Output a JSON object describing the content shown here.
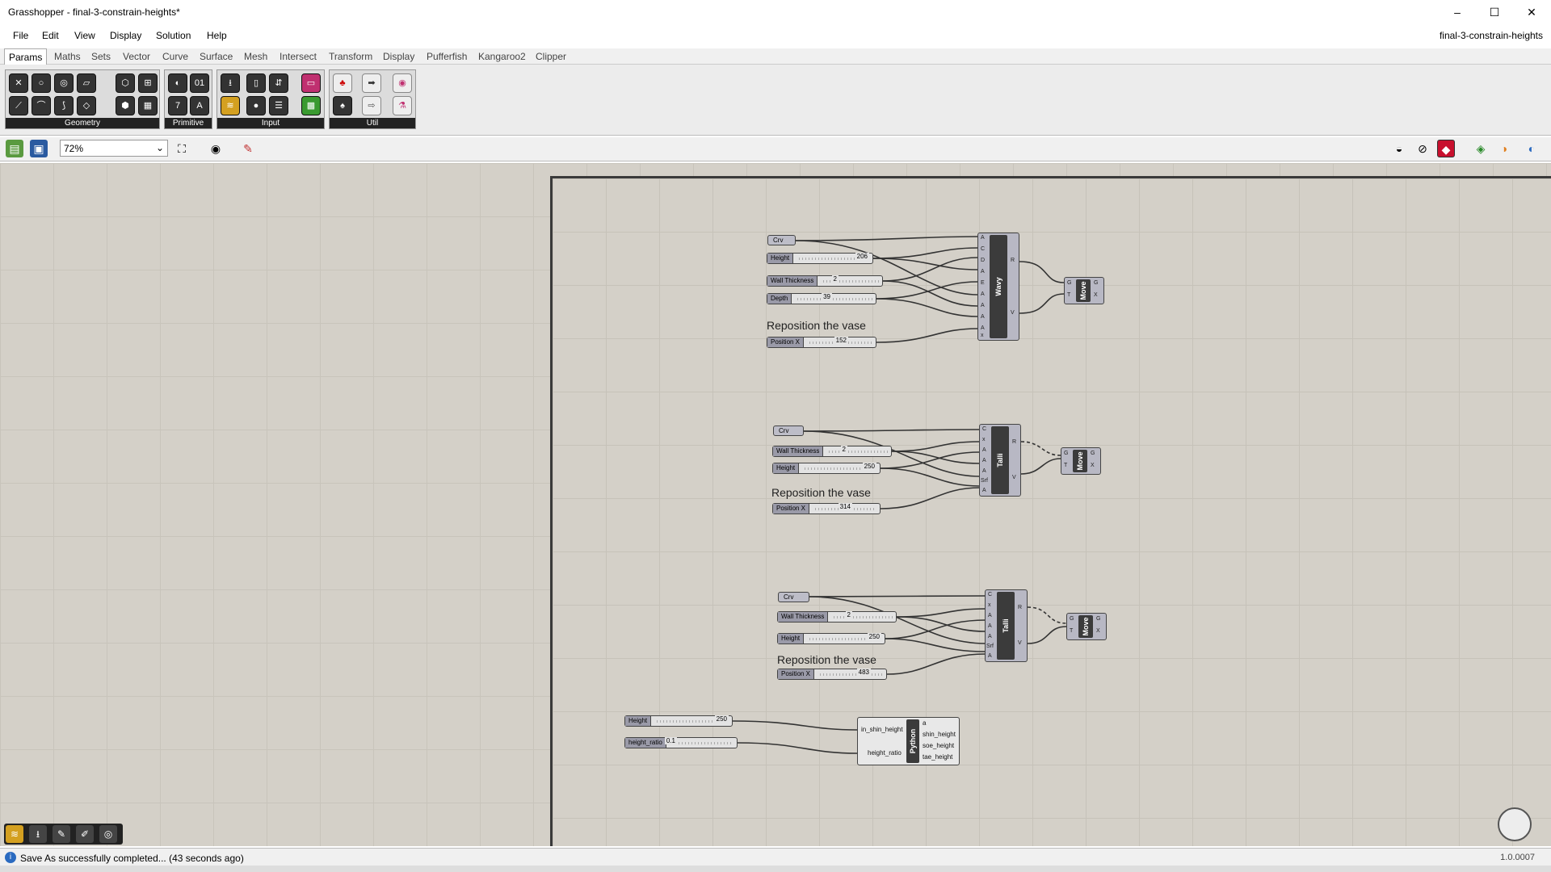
{
  "window": {
    "title": "Grasshopper - final-3-constrain-heights*",
    "doc_name": "final-3-constrain-heights",
    "minimize": "–",
    "maximize": "☐",
    "close": "✕"
  },
  "menu": [
    "File",
    "Edit",
    "View",
    "Display",
    "Solution",
    "Help"
  ],
  "tabs": [
    "Params",
    "Maths",
    "Sets",
    "Vector",
    "Curve",
    "Surface",
    "Mesh",
    "Intersect",
    "Transform",
    "Display",
    "Pufferfish",
    "Kangaroo2",
    "Clipper"
  ],
  "ribbon_groups": [
    "Geometry",
    "Primitive",
    "Input",
    "Util"
  ],
  "toolbar": {
    "zoom": "72%"
  },
  "canvas": {
    "group1": {
      "crv": "Crv",
      "height_label": "Height",
      "height_value": "206",
      "wall_label": "Wall Thickness",
      "wall_value": "2",
      "depth_label": "Depth",
      "depth_value": "39",
      "reposition": "Reposition the vase",
      "posx_label": "Position X",
      "posx_value": "152",
      "component": "Wavy",
      "inputs": [
        "A",
        "C",
        "D",
        "A",
        "E",
        "A",
        "A",
        "A",
        "A",
        "x"
      ],
      "outputs": [
        "R",
        "V"
      ],
      "move": "Move",
      "move_in": [
        "G",
        "T"
      ],
      "move_out": [
        "G",
        "X"
      ]
    },
    "group2": {
      "crv": "Crv",
      "wall_label": "Wall Thickness",
      "wall_value": "2",
      "height_label": "Height",
      "height_value": "250",
      "reposition": "Reposition the vase",
      "posx_label": "Position X",
      "posx_value": "314",
      "component": "Talli",
      "inputs": [
        "C",
        "x",
        "A",
        "A",
        "A",
        "Srf",
        "A"
      ],
      "outputs": [
        "R",
        "V"
      ],
      "move": "Move",
      "move_in": [
        "G",
        "T"
      ],
      "move_out": [
        "G",
        "X"
      ]
    },
    "group3": {
      "crv": "Crv",
      "wall_label": "Wall Thickness",
      "wall_value": "2",
      "height_label": "Height",
      "height_value": "250",
      "reposition": "Reposition the vase",
      "posx_label": "Position X",
      "posx_value": "483",
      "component": "Talli",
      "inputs": [
        "C",
        "x",
        "A",
        "A",
        "A",
        "Srf",
        "A"
      ],
      "outputs": [
        "R",
        "V"
      ],
      "move": "Move",
      "move_in": [
        "G",
        "T"
      ],
      "move_out": [
        "G",
        "X"
      ]
    },
    "python": {
      "height_label": "Height",
      "height_value": "250",
      "ratio_label": "height_ratio",
      "ratio_value": "0.1",
      "component": "Python",
      "inputs": [
        "in_shin_height",
        "height_ratio"
      ],
      "outputs": [
        "a",
        "shin_height",
        "soe_height",
        "tae_height"
      ]
    }
  },
  "status": {
    "message": "Save As successfully completed... (43 seconds ago)",
    "version": "1.0.0007"
  },
  "icons": [
    "open-file-icon",
    "save-icon",
    "zoom-extents-icon",
    "preview-eye-icon",
    "sketch-icon",
    "shaded-preview-icon",
    "wire-preview-icon",
    "selected-preview-icon",
    "compass-icon"
  ],
  "colors": {
    "canvas": "#d4d0c8",
    "component": "#b8b8c4",
    "component_core": "#3b3b3b",
    "wire": "#333333"
  }
}
